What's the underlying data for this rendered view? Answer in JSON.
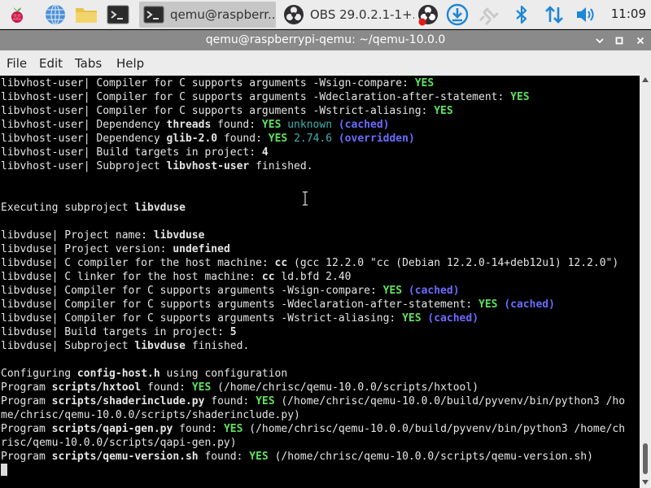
{
  "panel": {
    "tasks": [
      {
        "label": "qemu@raspberr..",
        "icon": "terminal-icon",
        "active": true
      },
      {
        "label": "OBS 29.0.2.1-1+...",
        "icon": "obs-icon",
        "active": false
      }
    ],
    "clock": "11:09"
  },
  "window": {
    "title": "qemu@raspberrypi-qemu: ~/qemu-10.0.0",
    "menu": [
      "File",
      "Edit",
      "Tabs",
      "Help"
    ]
  },
  "colors": {
    "yes": "#5fe05f",
    "cyan": "#3fb1b1",
    "blue": "#6b6bff",
    "titlebar": "#8a8a8a"
  },
  "terminal": {
    "lines": [
      [
        [
          "libvhost-user| Compiler for C supports arguments -Wsign-compare: ",
          ""
        ],
        [
          "YES",
          "g"
        ]
      ],
      [
        [
          "libvhost-user| Compiler for C supports arguments -Wdeclaration-after-statement: ",
          ""
        ],
        [
          "YES",
          "g"
        ]
      ],
      [
        [
          "libvhost-user| Compiler for C supports arguments -Wstrict-aliasing: ",
          ""
        ],
        [
          "YES",
          "g"
        ]
      ],
      [
        [
          "libvhost-user| Dependency ",
          ""
        ],
        [
          "threads",
          "b"
        ],
        [
          " found: ",
          ""
        ],
        [
          "YES",
          "g"
        ],
        [
          " ",
          ""
        ],
        [
          "unknown",
          "c"
        ],
        [
          " ",
          ""
        ],
        [
          "(cached)",
          "bl"
        ]
      ],
      [
        [
          "libvhost-user| Dependency ",
          ""
        ],
        [
          "glib-2.0",
          "b"
        ],
        [
          " found: ",
          ""
        ],
        [
          "YES",
          "g"
        ],
        [
          " ",
          ""
        ],
        [
          "2.74.6",
          "c"
        ],
        [
          " ",
          ""
        ],
        [
          "(overridden)",
          "bl"
        ]
      ],
      [
        [
          "libvhost-user| Build targets in project: ",
          ""
        ],
        [
          "4",
          "b"
        ]
      ],
      [
        [
          "libvhost-user| Subproject ",
          ""
        ],
        [
          "libvhost-user",
          "b"
        ],
        [
          " finished.",
          ""
        ]
      ],
      [],
      [],
      [
        [
          "Executing subproject ",
          ""
        ],
        [
          "libvduse",
          "b"
        ]
      ],
      [],
      [
        [
          "libvduse| Project name: ",
          ""
        ],
        [
          "libvduse",
          "b"
        ]
      ],
      [
        [
          "libvduse| Project version: ",
          ""
        ],
        [
          "undefined",
          "b"
        ]
      ],
      [
        [
          "libvduse| C compiler for the host machine: ",
          ""
        ],
        [
          "cc",
          "b"
        ],
        [
          " (gcc 12.2.0 \"cc (Debian 12.2.0-14+deb12u1) 12.2.0\")",
          ""
        ]
      ],
      [
        [
          "libvduse| C linker for the host machine: ",
          ""
        ],
        [
          "cc",
          "b"
        ],
        [
          " ld.bfd 2.40",
          ""
        ]
      ],
      [
        [
          "libvduse| Compiler for C supports arguments -Wsign-compare: ",
          ""
        ],
        [
          "YES",
          "g"
        ],
        [
          " ",
          ""
        ],
        [
          "(cached)",
          "bl"
        ]
      ],
      [
        [
          "libvduse| Compiler for C supports arguments -Wdeclaration-after-statement: ",
          ""
        ],
        [
          "YES",
          "g"
        ],
        [
          " ",
          ""
        ],
        [
          "(cached)",
          "bl"
        ]
      ],
      [
        [
          "libvduse| Compiler for C supports arguments -Wstrict-aliasing: ",
          ""
        ],
        [
          "YES",
          "g"
        ],
        [
          " ",
          ""
        ],
        [
          "(cached)",
          "bl"
        ]
      ],
      [
        [
          "libvduse| Build targets in project: ",
          ""
        ],
        [
          "5",
          "b"
        ]
      ],
      [
        [
          "libvduse| Subproject ",
          ""
        ],
        [
          "libvduse",
          "b"
        ],
        [
          " finished.",
          ""
        ]
      ],
      [],
      [
        [
          "Configuring ",
          ""
        ],
        [
          "config-host.h",
          "b"
        ],
        [
          " using configuration",
          ""
        ]
      ],
      [
        [
          "Program ",
          ""
        ],
        [
          "scripts/hxtool",
          "b"
        ],
        [
          " found: ",
          ""
        ],
        [
          "YES",
          "g"
        ],
        [
          " (/home/chrisc/qemu-10.0.0/scripts/hxtool)",
          ""
        ]
      ],
      [
        [
          "Program ",
          ""
        ],
        [
          "scripts/shaderinclude.py",
          "b"
        ],
        [
          " found: ",
          ""
        ],
        [
          "YES",
          "g"
        ],
        [
          " (/home/chrisc/qemu-10.0.0/build/pyvenv/bin/python3 /ho",
          ""
        ]
      ],
      [
        [
          "me/chrisc/qemu-10.0.0/scripts/shaderinclude.py)",
          ""
        ]
      ],
      [
        [
          "Program ",
          ""
        ],
        [
          "scripts/qapi-gen.py",
          "b"
        ],
        [
          " found: ",
          ""
        ],
        [
          "YES",
          "g"
        ],
        [
          " (/home/chrisc/qemu-10.0.0/build/pyvenv/bin/python3 /home/ch",
          ""
        ]
      ],
      [
        [
          "risc/qemu-10.0.0/scripts/qapi-gen.py)",
          ""
        ]
      ],
      [
        [
          "Program ",
          ""
        ],
        [
          "scripts/qemu-version.sh",
          "b"
        ],
        [
          " found: ",
          ""
        ],
        [
          "YES",
          "g"
        ],
        [
          " (/home/chrisc/qemu-10.0.0/scripts/qemu-version.sh)",
          ""
        ]
      ]
    ]
  }
}
